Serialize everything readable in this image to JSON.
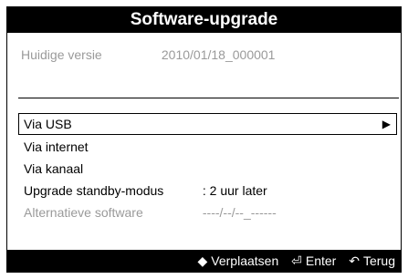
{
  "dialog": {
    "title": "Software-upgrade",
    "current_version_label": "Huidige versie",
    "current_version_value": "2010/01/18_000001"
  },
  "menu": {
    "items": [
      {
        "label": "Via USB",
        "selected": true
      },
      {
        "label": "Via internet"
      },
      {
        "label": "Via kanaal"
      },
      {
        "label": "Upgrade standby-modus",
        "value": ": 2 uur later"
      },
      {
        "label": "Alternatieve software",
        "value": "----/--/--_------",
        "disabled": true
      }
    ]
  },
  "footer": {
    "hints": [
      {
        "icon": "up-down-arrows-icon",
        "label": "Verplaatsen"
      },
      {
        "icon": "enter-icon",
        "label": "Enter"
      },
      {
        "icon": "return-icon",
        "label": "Terug"
      }
    ]
  }
}
